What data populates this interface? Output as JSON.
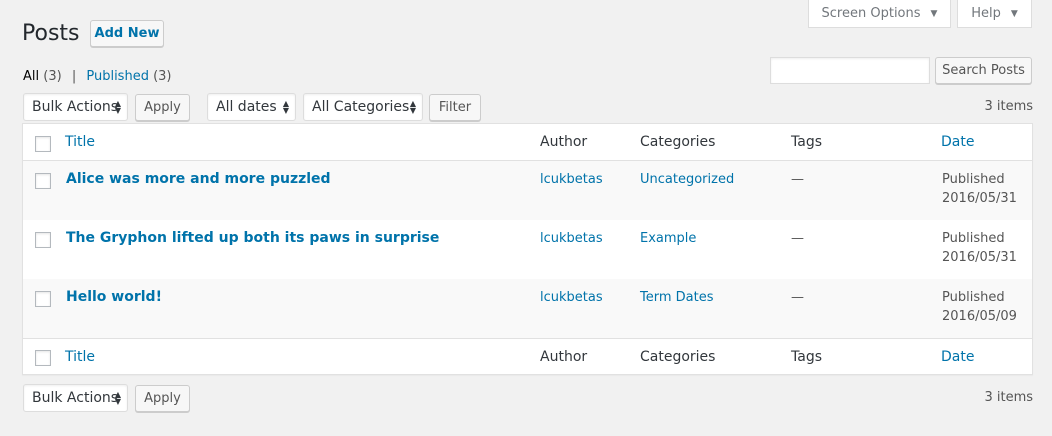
{
  "header": {
    "title": "Posts",
    "add_new_label": "Add New",
    "screen_options_label": "Screen Options",
    "help_label": "Help"
  },
  "subsubsub": {
    "all_label": "All",
    "all_count": "(3)",
    "separator": "|",
    "published_label": "Published",
    "published_count": "(3)"
  },
  "search": {
    "value": "",
    "button_label": "Search Posts"
  },
  "tablenav_top": {
    "bulk_actions": "Bulk Actions",
    "apply_label": "Apply",
    "dates": "All dates",
    "categories": "All Categories",
    "filter_label": "Filter",
    "items_count": "3 items"
  },
  "tablenav_bottom": {
    "bulk_actions": "Bulk Actions",
    "apply_label": "Apply",
    "items_count": "3 items"
  },
  "table": {
    "columns": {
      "title": "Title",
      "author": "Author",
      "categories": "Categories",
      "tags": "Tags",
      "date": "Date"
    },
    "rows": [
      {
        "title": "Alice was more and more puzzled",
        "author": "lcukbetas",
        "category": "Uncategorized",
        "tags": "—",
        "status": "Published",
        "date": "2016/05/31"
      },
      {
        "title": "The Gryphon lifted up both its paws in surprise",
        "author": "lcukbetas",
        "category": "Example",
        "tags": "—",
        "status": "Published",
        "date": "2016/05/31"
      },
      {
        "title": "Hello world!",
        "author": "lcukbetas",
        "category": "Term Dates",
        "tags": "—",
        "status": "Published",
        "date": "2016/05/09"
      }
    ]
  },
  "colors": {
    "link": "#0073aa",
    "background": "#f1f1f1",
    "alt_row": "#f9f9f9"
  }
}
